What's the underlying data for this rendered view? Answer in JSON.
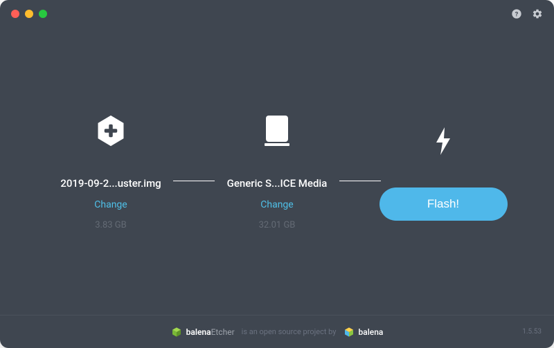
{
  "titlebar": {
    "icons": [
      "help",
      "settings"
    ]
  },
  "steps": {
    "image": {
      "name": "2019-09-2...uster.img",
      "change": "Change",
      "size": "3.83 GB"
    },
    "drive": {
      "name": "Generic S...ICE Media",
      "change": "Change",
      "size": "32.01 GB"
    },
    "flash": {
      "label": "Flash!"
    }
  },
  "footer": {
    "product_brand1": "balena",
    "product_brand2": "Etcher",
    "tagline": "is an open source project by",
    "company": "balena",
    "version": "1.5.53"
  }
}
